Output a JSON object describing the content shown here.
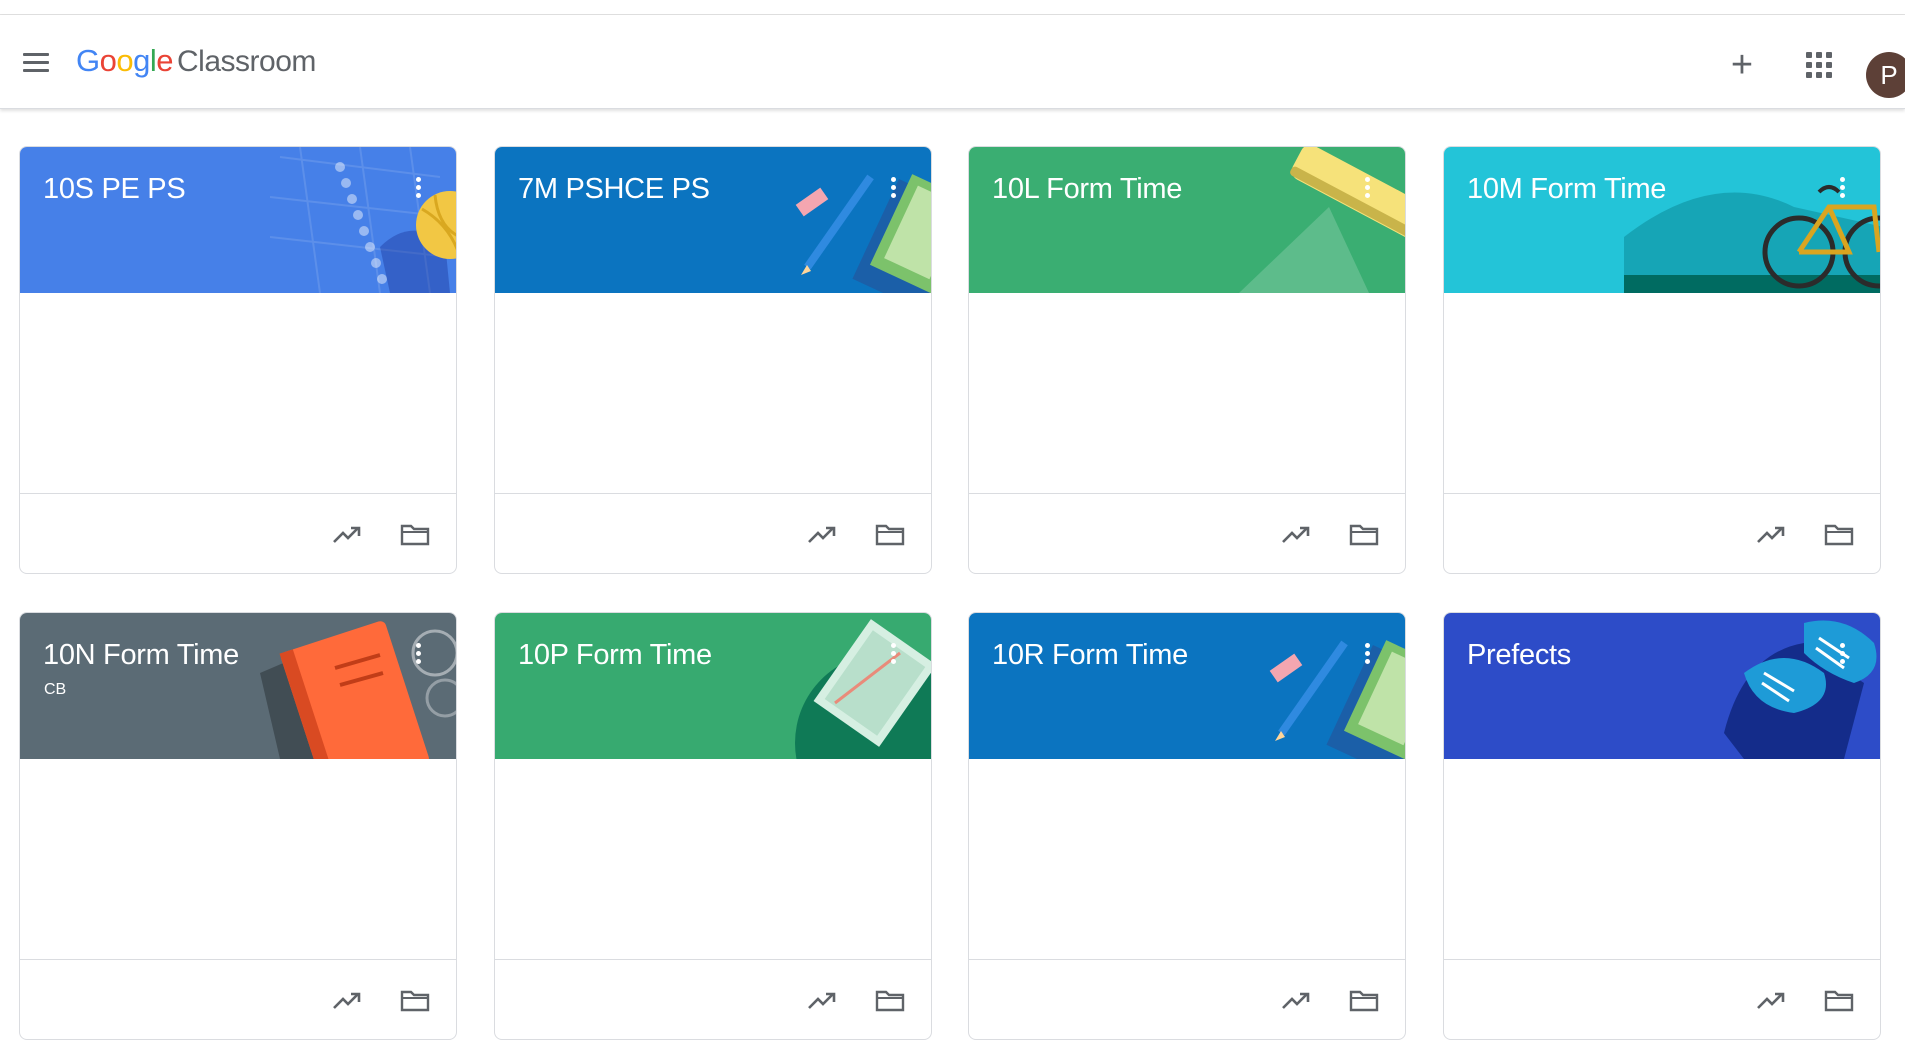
{
  "app": {
    "logo_letters": [
      {
        "ch": "G",
        "color": "#4285f4"
      },
      {
        "ch": "o",
        "color": "#ea4335"
      },
      {
        "ch": "o",
        "color": "#fbbc05"
      },
      {
        "ch": "g",
        "color": "#4285f4"
      },
      {
        "ch": "l",
        "color": "#34a853"
      },
      {
        "ch": "e",
        "color": "#ea4335"
      }
    ],
    "product_name": "Classroom",
    "create_label": "+",
    "avatar_initial": "P",
    "avatar_color": "#5d4037"
  },
  "icons": {
    "menu": "menu-icon",
    "create": "plus-icon",
    "apps": "apps-grid-icon",
    "gradebook": "trending-up-icon",
    "drive": "folder-icon",
    "options": "more-vert-icon"
  },
  "classes": [
    {
      "name": "10S PE PS",
      "subtitle": "",
      "color": "#4680e8",
      "art": "ball"
    },
    {
      "name": "7M PSHCE PS",
      "subtitle": "",
      "color": "#0b74c0",
      "art": "pencil"
    },
    {
      "name": "10L Form Time",
      "subtitle": "",
      "color": "#3aae72",
      "art": "ruler"
    },
    {
      "name": "10M Form Time",
      "subtitle": "",
      "color": "#23c4d8",
      "art": "bike"
    },
    {
      "name": "10N Form Time",
      "subtitle": "CB",
      "color": "#5b6b75",
      "art": "book"
    },
    {
      "name": "10P Form Time",
      "subtitle": "",
      "color": "#37aa70",
      "art": "notebook"
    },
    {
      "name": "10R Form Time",
      "subtitle": "",
      "color": "#0b74c0",
      "art": "pencil"
    },
    {
      "name": "Prefects",
      "subtitle": "",
      "color": "#2d4cc8",
      "art": "shoes"
    }
  ]
}
